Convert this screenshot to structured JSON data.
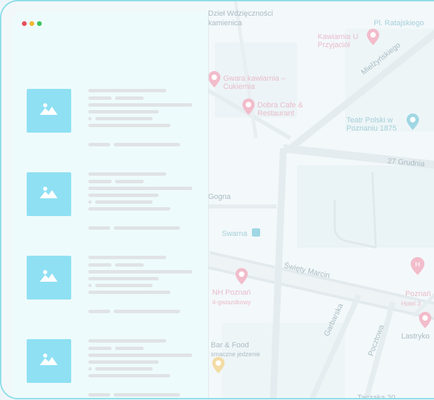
{
  "window": {
    "controls": [
      {
        "name": "close",
        "color": "#e8505b"
      },
      {
        "name": "minimize",
        "color": "#f2b632"
      },
      {
        "name": "maximize",
        "color": "#3fc35e"
      }
    ]
  },
  "listings": {
    "count": 4,
    "placeholder_icon": "image-icon",
    "thumbnail_color": "#8fe0f3"
  },
  "map": {
    "labels": {
      "wodzieczowa": "Dzieł Wdzięczności",
      "kamiennica": "kamienica",
      "ratajskiego": "Pl. Ratajskiego",
      "kawiarnia": "Kawiarnia U Przyjaciół",
      "mielzynskiego": "Mielżyńskiego",
      "gwara": "Gwara kawiarnia – Cukiernia",
      "dobra": "Dobra Cafe & Restaurant",
      "teatr": "Teatr Polski w Poznaniu 1875",
      "grudnia": "27 Grudnia",
      "swarna": "Swarna",
      "gogna": "Gogna",
      "swiety": "Święty Marcin",
      "nh": "NH Poznań",
      "nh_sub": "4-gwiazdkowy",
      "garbarska": "Garbarska",
      "pocztowa": "Pocztowa",
      "hotel": "Poznań",
      "hotel_sub": "Hotel 3",
      "lastryko": "Lastryko",
      "tacinka": "Taczaka 20",
      "bar": "Bar & Food",
      "bar_sub": "smaczne jedzenie"
    }
  }
}
